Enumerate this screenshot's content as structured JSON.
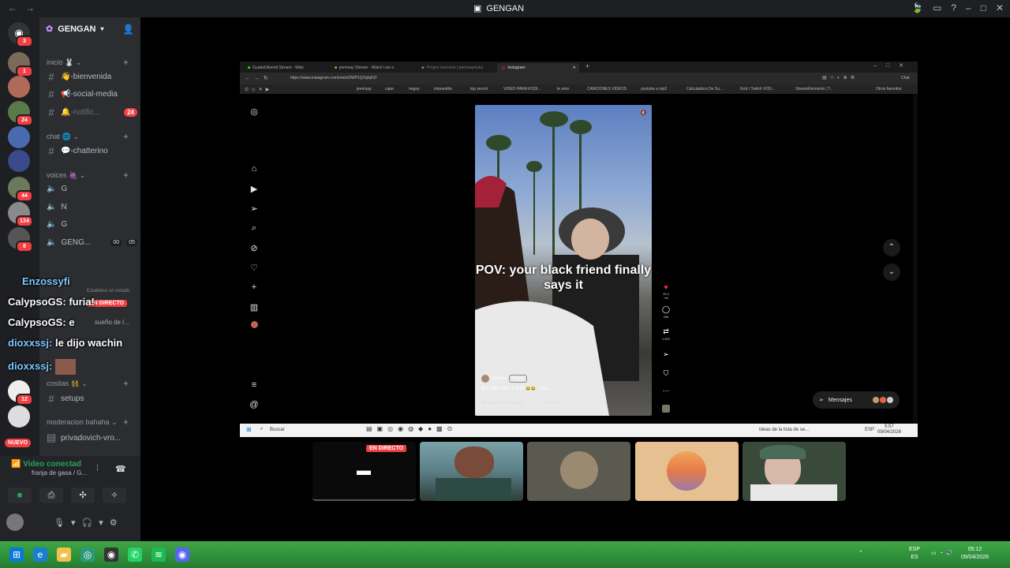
{
  "window": {
    "title": "GENGAN"
  },
  "servers": {
    "badges": [
      "3",
      "1",
      "24",
      "44",
      "134",
      "8",
      "12"
    ]
  },
  "sidebar": {
    "server_name": "GENGAN",
    "categories": {
      "inicio": "inicio 🐰",
      "chat": "chat 🌐",
      "voices": "voices 🍇",
      "cositas": "cositas 👯",
      "moderacion": "moderacion bahaha"
    },
    "channels": {
      "bienvenida": "👋-bienvenida",
      "social_media": "📢-social-media",
      "notificaciones": "🔔-notific...",
      "notificaciones_badge": "24",
      "chatterino": "💬-chatterino",
      "setups": "setups",
      "privadovich": "privadovich-vro..."
    },
    "voice_channels": [
      "G",
      "N",
      "G",
      "GENG..."
    ],
    "voice_counts": [
      "00",
      "05"
    ],
    "new_badge": "NUEVO"
  },
  "voice_panel": {
    "status": "Video conectad",
    "channel": "franja de gasa / G..."
  },
  "chat_overlay": [
    {
      "user": "Enzossyfi",
      "msg": ""
    },
    {
      "user": "CalypsoGS:",
      "msg": "furia!"
    },
    {
      "user": "CalypsoGS:",
      "msg": "e"
    },
    {
      "user": "dioxxssj:",
      "msg": "le dijo wachin"
    },
    {
      "user": "dioxxssj:",
      "msg": ""
    }
  ],
  "overlay_fragments": {
    "en_directo": "EN DIRECTO",
    "sueno": "sueño de l...",
    "establece": "Establece un estado"
  },
  "browser": {
    "tabs": [
      "GuadaUbiendi Stream - Watc",
      "jeemsay Stream - Watch Live o",
      "Project overview | jeemsay/subs",
      "Instagram"
    ],
    "url": "https://www.instagram.com/reels/DWP1QOpkjH2/",
    "chat_label": "Chat",
    "bookmarks": [
      "jeemsay",
      "cape",
      "negey",
      "impuestito",
      "top secret",
      "VIDEO PARA KODI...",
      "te amo",
      "CANCIONES VIDEOS",
      "youtube a mp3",
      "Calculadora De Su...",
      "Kick / Twitch VOD...",
      "StreamElements | T..."
    ],
    "other_favorites": "Otros favoritos"
  },
  "reel": {
    "overlay_text": "POV: your black friend finally says it",
    "username": "jfromslv",
    "follow": "Seguir",
    "caption": "BUT CAN I SAY IT NOW 😂😂 ... más",
    "audio": "jfromslv · Audio original",
    "tagged": "jeymsy",
    "likes": "39,4 mil",
    "comments": "266",
    "reposts": "1.603",
    "messages_label": "Mensajes"
  },
  "win_taskbar": {
    "search": "Buscar",
    "notice": "Ideas de la lista de se...",
    "lang": "ESP",
    "time": "5:57",
    "date": "09/04/2026"
  },
  "tiles": {
    "live": "EN DIRECTO"
  },
  "desktop_tray": {
    "lang": "ESP",
    "lang2": "ES",
    "time": "05:12",
    "date": "09/04/2026"
  }
}
